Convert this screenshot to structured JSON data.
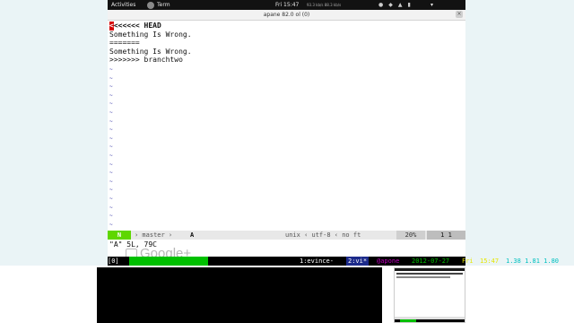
{
  "topbar": {
    "activities": "Activities",
    "app_name": "Term",
    "clock": "Fri 15:47",
    "net_rate": "93.3 kb/s   88.3 kb/s"
  },
  "window": {
    "title": "apane 82.0 ol (0)"
  },
  "editor": {
    "lines": [
      "<<<<<<< HEAD",
      "Something Is Wrong.",
      "=======",
      "Something Is Wrong.",
      ">>>>>>> branchtwo"
    ],
    "tilde": "~"
  },
  "statusline": {
    "mode": "N",
    "branch": "› master ›",
    "buffer": "A",
    "encoding": "unix ‹ utf-8 ‹ no ft",
    "percent": "20%",
    "position": "1  1"
  },
  "cmdline": {
    "text": "\"A\" 5L, 79C"
  },
  "watermark": {
    "text": "Google+"
  },
  "tmux": {
    "session": "[0]",
    "window1": "1:evince-",
    "window2": "2:vi*",
    "host": "@apone",
    "date": "2012-07-27",
    "day": "Fri",
    "time": "15:47",
    "load": "1.38 1.81 1.80"
  },
  "colors": {
    "mode_green": "#5fd700",
    "tmux_green": "#00c000",
    "cursor_red": "#d40000",
    "side_bg": "#eaf4f6"
  }
}
